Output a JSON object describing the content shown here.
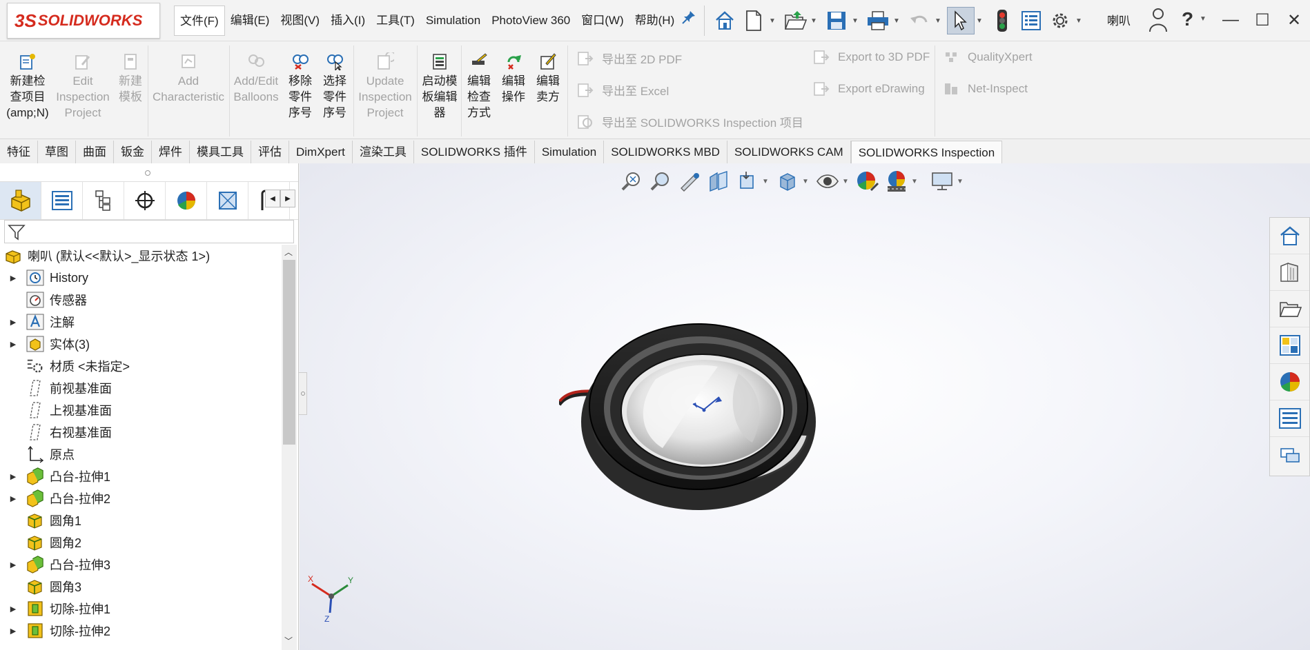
{
  "app": {
    "logo_prefix": "3S",
    "logo_text": "SOLIDWORKS"
  },
  "menu": [
    {
      "label": "文件(F)",
      "active": true
    },
    {
      "label": "编辑(E)"
    },
    {
      "label": "视图(V)"
    },
    {
      "label": "插入(I)"
    },
    {
      "label": "工具(T)"
    },
    {
      "label": "Simulation"
    },
    {
      "label": "PhotoView 360"
    },
    {
      "label": "窗口(W)"
    },
    {
      "label": "帮助(H)"
    }
  ],
  "quick_icons": [
    "home-icon",
    "new-document-icon",
    "open-icon",
    "save-icon",
    "print-icon",
    "undo-icon",
    "select-pointer-icon",
    "traffic-light-icon",
    "options-list-icon",
    "gear-icon"
  ],
  "user_name": "喇叭",
  "help_symbol": "?",
  "window_controls": {
    "minimize": "—",
    "maximize": "☐",
    "close": "✕"
  },
  "ribbon": {
    "buttons": [
      {
        "label": "新建检\n查项目\n(amp;N)",
        "disabled": false,
        "icon": "new-inspection-icon"
      },
      {
        "label": "Edit\nInspection\nProject",
        "disabled": true,
        "icon": "edit-inspection-icon"
      },
      {
        "label": "新建\n模板",
        "disabled": true,
        "icon": "new-template-icon"
      },
      {
        "label": "Add\nCharacteristic",
        "disabled": true,
        "icon": "add-characteristic-icon"
      },
      {
        "label": "Add/Edit\nBalloons",
        "disabled": true,
        "icon": "balloons-icon"
      },
      {
        "label": "移除\n零件\n序号",
        "disabled": false,
        "icon": "remove-balloon-icon"
      },
      {
        "label": "选择\n零件\n序号",
        "disabled": false,
        "icon": "select-balloon-icon"
      },
      {
        "label": "Update\nInspection\nProject",
        "disabled": true,
        "icon": "update-inspection-icon"
      },
      {
        "label": "启动模\n板编辑\n器",
        "disabled": false,
        "icon": "template-editor-icon"
      },
      {
        "label": "编辑\n检查\n方式",
        "disabled": false,
        "icon": "edit-method-icon"
      },
      {
        "label": "编辑\n操作",
        "disabled": false,
        "icon": "edit-operation-icon"
      },
      {
        "label": "编辑\n卖方",
        "disabled": false,
        "icon": "edit-vendor-icon"
      }
    ],
    "export_items": [
      "导出至 2D PDF",
      "导出至 Excel",
      "导出至 SOLIDWORKS Inspection 项目",
      "Export to 3D PDF",
      "Export eDrawing",
      "QualityXpert",
      "Net-Inspect"
    ]
  },
  "tabs": [
    {
      "label": "特征"
    },
    {
      "label": "草图"
    },
    {
      "label": "曲面"
    },
    {
      "label": "钣金"
    },
    {
      "label": "焊件"
    },
    {
      "label": "模具工具"
    },
    {
      "label": "评估"
    },
    {
      "label": "DimXpert"
    },
    {
      "label": "渲染工具"
    },
    {
      "label": "SOLIDWORKS 插件"
    },
    {
      "label": "Simulation"
    },
    {
      "label": "SOLIDWORKS MBD"
    },
    {
      "label": "SOLIDWORKS CAM"
    },
    {
      "label": "SOLIDWORKS Inspection",
      "selected": true
    }
  ],
  "feature_tree": {
    "root": "喇叭 (默认<<默认>_显示状态 1>)",
    "items": [
      {
        "label": "History",
        "expandable": true,
        "icon": "history-icon"
      },
      {
        "label": "传感器",
        "expandable": false,
        "icon": "sensor-icon"
      },
      {
        "label": "注解",
        "expandable": true,
        "icon": "annotation-icon"
      },
      {
        "label": "实体(3)",
        "expandable": true,
        "icon": "solid-bodies-icon"
      },
      {
        "label": "材质 <未指定>",
        "expandable": false,
        "icon": "material-icon"
      },
      {
        "label": "前视基准面",
        "expandable": false,
        "icon": "plane-icon"
      },
      {
        "label": "上视基准面",
        "expandable": false,
        "icon": "plane-icon"
      },
      {
        "label": "右视基准面",
        "expandable": false,
        "icon": "plane-icon"
      },
      {
        "label": "原点",
        "expandable": false,
        "icon": "origin-icon"
      },
      {
        "label": "凸台-拉伸1",
        "expandable": true,
        "icon": "boss-extrude-icon"
      },
      {
        "label": "凸台-拉伸2",
        "expandable": true,
        "icon": "boss-extrude-icon"
      },
      {
        "label": "圆角1",
        "expandable": false,
        "icon": "fillet-icon"
      },
      {
        "label": "圆角2",
        "expandable": false,
        "icon": "fillet-icon"
      },
      {
        "label": "凸台-拉伸3",
        "expandable": true,
        "icon": "boss-extrude-icon"
      },
      {
        "label": "圆角3",
        "expandable": false,
        "icon": "fillet-icon"
      },
      {
        "label": "切除-拉伸1",
        "expandable": true,
        "icon": "cut-extrude-icon"
      },
      {
        "label": "切除-拉伸2",
        "expandable": true,
        "icon": "cut-extrude-icon"
      }
    ]
  },
  "triad": {
    "x": "X",
    "y": "Y",
    "z": "Z"
  },
  "colors": {
    "accent": "#d52b1e",
    "selected_tab_bg": "#fafafa",
    "ui_bg": "#f3f3f3",
    "icon_blue": "#2a6fb5"
  }
}
